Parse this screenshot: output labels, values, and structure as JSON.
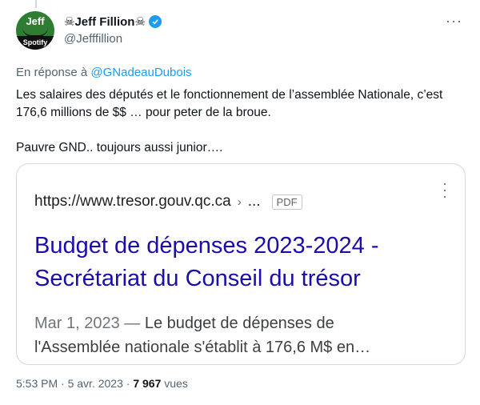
{
  "author": {
    "display_name": "Jeff Fillion",
    "name_decoration_left": "☠",
    "name_decoration_right": "☠",
    "handle": "@Jefffillion",
    "avatar_top_text": "Jeff",
    "avatar_bottom_text": "Spotify"
  },
  "reply": {
    "prefix": "En réponse à",
    "mention": "@GNadeauDubois"
  },
  "tweet": {
    "line1": "Les salaires des députés et le fonctionnement de l’assemblée Nationale, c’est 176,6 millions de $$ … pour peter de la broue.",
    "line2": "Pauvre GND.. toujours aussi junior…."
  },
  "card": {
    "url": "https://www.tresor.gouv.qc.ca",
    "url_sep": "›",
    "url_more": "...",
    "badge": "PDF",
    "title_line1": "Budget de dépenses 2023-2024 -",
    "title_line2": "Secrétariat du Conseil du trésor",
    "date": "Mar 1, 2023",
    "dash": "—",
    "snippet_line1": "Le budget de dépenses de",
    "snippet_line2": "l'Assemblée nationale s'établit à 176,6 M$ en…"
  },
  "meta": {
    "time": "5:53 PM",
    "date": "5 avr. 2023",
    "dot": "·",
    "views_count": "7 967",
    "views_label": "vues"
  },
  "colors": {
    "link": "#1d9bf0",
    "card_title": "#1a0dab",
    "verified": "#1d9bf0"
  }
}
